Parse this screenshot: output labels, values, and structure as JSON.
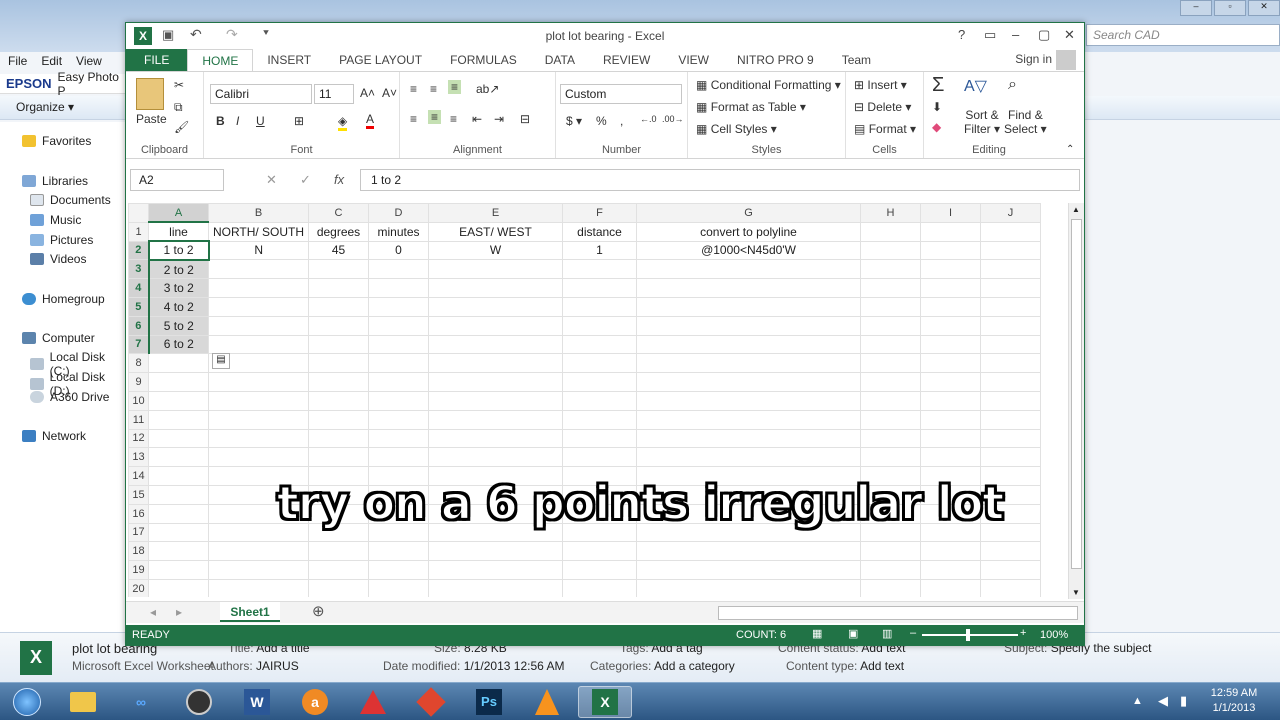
{
  "explorer": {
    "menu": [
      "File",
      "Edit",
      "View",
      "T"
    ],
    "epson_brand": "EPSON",
    "epson_app": "Easy Photo P",
    "organize": "Organize ▾",
    "search_placeholder": "Search CAD",
    "nav": {
      "favorites": "Favorites",
      "libraries": "Libraries",
      "documents": "Documents",
      "music": "Music",
      "pictures": "Pictures",
      "videos": "Videos",
      "homegroup": "Homegroup",
      "computer": "Computer",
      "local_c": "Local Disk (C:)",
      "local_d": "Local Disk (D:)",
      "a360": "A360 Drive",
      "network": "Network"
    },
    "details": {
      "filename": "plot lot bearing",
      "filetype": "Microsoft Excel Worksheet",
      "authors_label": "Authors:",
      "authors": "JAIRUS",
      "title_label": "Title:",
      "title": "Add a title",
      "size_label": "Size:",
      "size": "8.28 KB",
      "modified_label": "Date modified:",
      "modified": "1/1/2013 12:56 AM",
      "tags_label": "Tags:",
      "tags": "Add a tag",
      "categories_label": "Categories:",
      "categories": "Add a category",
      "content_status_label": "Content status:",
      "content_status": "Add text",
      "content_type_label": "Content type:",
      "content_type": "Add text",
      "subject_label": "Subject:",
      "subject": "Specify the subject"
    }
  },
  "excel": {
    "title": "plot lot bearing - Excel",
    "tabs": [
      "FILE",
      "HOME",
      "INSERT",
      "PAGE LAYOUT",
      "FORMULAS",
      "DATA",
      "REVIEW",
      "VIEW",
      "NITRO PRO 9",
      "Team"
    ],
    "signin": "Sign in",
    "ribbon": {
      "paste": "Paste",
      "clipboard": "Clipboard",
      "font_name": "Calibri",
      "font_size": "11",
      "font": "Font",
      "alignment": "Alignment",
      "number_format": "Custom",
      "number": "Number",
      "conditional": "Conditional Formatting ▾",
      "format_table": "Format as Table ▾",
      "cell_styles": "Cell Styles ▾",
      "styles": "Styles",
      "insert": "Insert",
      "delete": "Delete",
      "format": "Format",
      "cells": "Cells",
      "sort": "Sort &",
      "filter": "Filter ▾",
      "find": "Find &",
      "select": "Select ▾",
      "editing": "Editing"
    },
    "namebox": "A2",
    "formula": "1 to 2",
    "columns": [
      "A",
      "B",
      "C",
      "D",
      "E",
      "F",
      "G",
      "H",
      "I",
      "J"
    ],
    "rows": [
      [
        "line",
        "NORTH/ SOUTH",
        "degrees",
        "minutes",
        "EAST/ WEST",
        "distance",
        "convert to polyline",
        "",
        "",
        ""
      ],
      [
        "1 to 2",
        "N",
        "45",
        "0",
        "W",
        "1",
        "@1000<N45d0'W",
        "",
        "",
        ""
      ],
      [
        "2 to 2",
        "",
        "",
        "",
        "",
        "",
        "",
        "",
        "",
        ""
      ],
      [
        "3 to 2",
        "",
        "",
        "",
        "",
        "",
        "",
        "",
        "",
        ""
      ],
      [
        "4 to 2",
        "",
        "",
        "",
        "",
        "",
        "",
        "",
        "",
        ""
      ],
      [
        "5 to 2",
        "",
        "",
        "",
        "",
        "",
        "",
        "",
        "",
        ""
      ],
      [
        "6 to 2",
        "",
        "",
        "",
        "",
        "",
        "",
        "",
        "",
        ""
      ]
    ],
    "sheet": "Sheet1",
    "status_ready": "READY",
    "status_count": "COUNT: 6",
    "zoom": "100%"
  },
  "taskbar": {
    "time": "12:59 AM",
    "date": "1/1/2013"
  },
  "caption": "try on a 6 points irregular lot",
  "colors": {
    "excel_green": "#217346",
    "taskbar": "#2c5683"
  }
}
